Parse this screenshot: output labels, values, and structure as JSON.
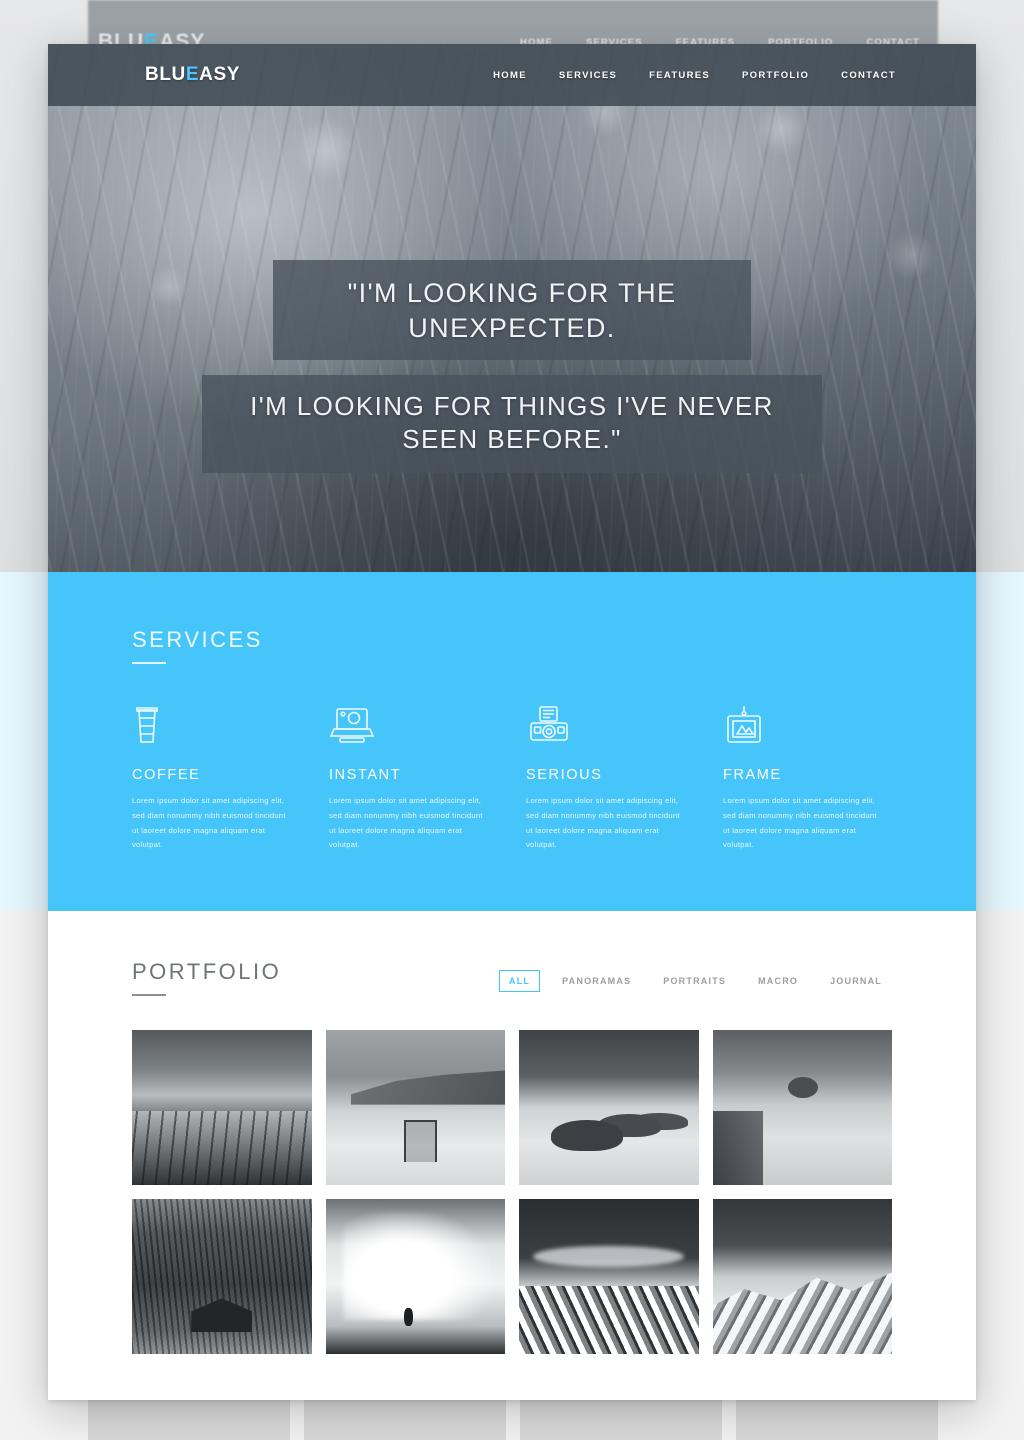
{
  "site": {
    "logo_text_primary": "BLU",
    "logo_text_accent": "E",
    "logo_text_suffix": "ASY",
    "logo_full": "BLUEASY",
    "accent_color": "#45c5fa",
    "nav_bar_color": "#3e4851"
  },
  "nav": {
    "items": [
      {
        "label": "HOME"
      },
      {
        "label": "SERVICES"
      },
      {
        "label": "FEATURES"
      },
      {
        "label": "PORTFOLIO"
      },
      {
        "label": "CONTACT"
      }
    ]
  },
  "hero": {
    "quote_line_1": "\"I'M LOOKING FOR THE UNEXPECTED.",
    "quote_line_2": "I'M LOOKING FOR THINGS I'VE NEVER SEEN BEFORE.\""
  },
  "services": {
    "title": "SERVICES",
    "items": [
      {
        "icon": "coffee-cup-icon",
        "name": "COFFEE",
        "text": "Lorem ipsum dolor sit amet adipiscing elit, sed diam nonummy nibh euismod tincidunt ut laoreet dolore magna aliquam erat volutpat."
      },
      {
        "icon": "instant-camera-icon",
        "name": "INSTANT",
        "text": "Lorem ipsum dolor sit amet adipiscing elit, sed diam nonummy nibh euismod tincidunt ut laoreet dolore magna aliquam erat volutpat."
      },
      {
        "icon": "dslr-camera-icon",
        "name": "SERIOUS",
        "text": "Lorem ipsum dolor sit amet adipiscing elit, sed diam nonummy nibh euismod tincidunt ut laoreet dolore magna aliquam erat volutpat."
      },
      {
        "icon": "picture-frame-icon",
        "name": "FRAME",
        "text": "Lorem ipsum dolor sit amet adipiscing elit, sed diam nonummy nibh euismod tincidunt ut laoreet dolore magna aliquam erat volutpat."
      }
    ]
  },
  "portfolio": {
    "title": "PORTFOLIO",
    "filters": [
      {
        "label": "ALL",
        "active": true
      },
      {
        "label": "PANORAMAS",
        "active": false
      },
      {
        "label": "PORTRAITS",
        "active": false
      },
      {
        "label": "MACRO",
        "active": false
      },
      {
        "label": "JOURNAL",
        "active": false
      }
    ],
    "items": [
      {
        "name": "curved-pier-photo"
      },
      {
        "name": "bridge-in-fog-photo"
      },
      {
        "name": "sea-rocks-photo"
      },
      {
        "name": "lone-tree-island-photo"
      },
      {
        "name": "forest-cabin-photo"
      },
      {
        "name": "breaking-wave-photo"
      },
      {
        "name": "mountain-peaks-photo"
      },
      {
        "name": "snowy-ridge-photo"
      }
    ]
  }
}
